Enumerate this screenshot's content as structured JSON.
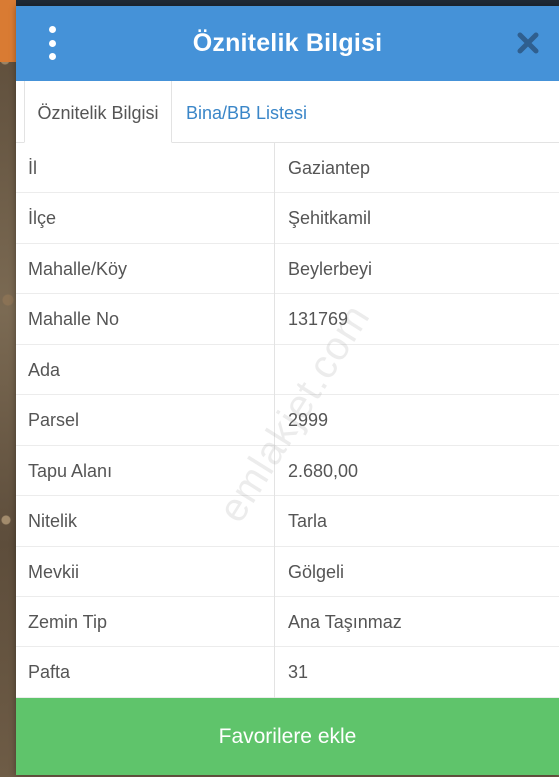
{
  "dialog": {
    "title": "Öznitelik Bilgisi",
    "menu_icon": "more-vertical-icon",
    "close_icon": "close-icon"
  },
  "tabs": [
    {
      "label": "Öznitelik Bilgisi",
      "active": true
    },
    {
      "label": "Bina/BB Listesi",
      "active": false
    }
  ],
  "attributes": [
    {
      "key": "İl",
      "value": "Gaziantep"
    },
    {
      "key": "İlçe",
      "value": "Şehitkamil"
    },
    {
      "key": "Mahalle/Köy",
      "value": "Beylerbeyi"
    },
    {
      "key": "Mahalle No",
      "value": "131769"
    },
    {
      "key": "Ada",
      "value": ""
    },
    {
      "key": "Parsel",
      "value": "2999"
    },
    {
      "key": "Tapu Alanı",
      "value": "2.680,00"
    },
    {
      "key": "Nitelik",
      "value": "Tarla"
    },
    {
      "key": "Mevkii",
      "value": "Gölgeli"
    },
    {
      "key": "Zemin Tip",
      "value": "Ana Taşınmaz"
    },
    {
      "key": "Pafta",
      "value": "31"
    }
  ],
  "footer": {
    "button_label": "Favorilere ekle"
  },
  "watermark": "emlakjet.com",
  "colors": {
    "header": "#4592d8",
    "footer_button": "#5fc46b",
    "tab_link": "#3a86c8"
  }
}
